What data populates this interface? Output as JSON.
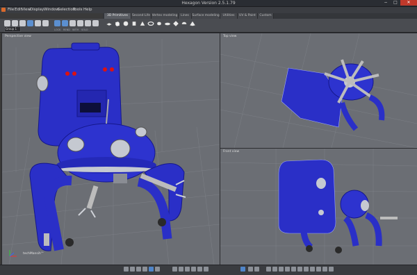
{
  "window": {
    "title": "Hexagon Version 2.5.1.79"
  },
  "menu": [
    "File",
    "Edit",
    "View",
    "Display",
    "Window",
    "Selection",
    "Tools",
    "Help"
  ],
  "tabs": [
    {
      "label": "3D Primitives",
      "active": true
    },
    {
      "label": "Second Life",
      "active": false
    },
    {
      "label": "Vertex modeling",
      "active": false
    },
    {
      "label": "Lines",
      "active": false
    },
    {
      "label": "Surface modeling",
      "active": false
    },
    {
      "label": "Utilities",
      "active": false
    },
    {
      "label": "UV & Paint",
      "active": false
    },
    {
      "label": "Custom",
      "active": false
    }
  ],
  "toolbar": {
    "object_select": "Group 1",
    "tiny_labels": [
      "LOCK",
      "REND",
      "WITH",
      "SOLO"
    ]
  },
  "viewports": {
    "perspective": {
      "label": "Perspective view",
      "watermark": "techMansih™"
    },
    "top": {
      "label": "Top view"
    },
    "front": {
      "label": "Front view"
    }
  },
  "colors": {
    "model_blue": "#2a2fc7",
    "viewport_bg": "#6b6e74",
    "active_blue": "#5b8fd0",
    "close_red": "#c0392b"
  },
  "icons": {
    "window_min": "−",
    "window_max": "□",
    "window_close": "✕"
  }
}
